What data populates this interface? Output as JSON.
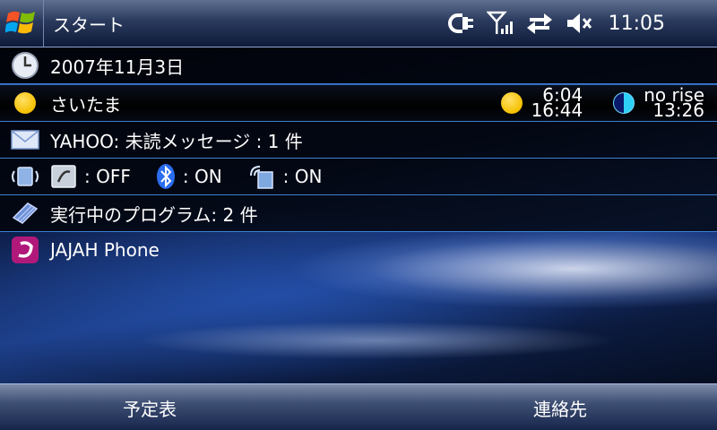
{
  "titlebar": {
    "title": "スタート",
    "time": "11:05",
    "icons": [
      "windows-logo-icon",
      "power-plug-icon",
      "signal-strength-icon",
      "data-transfer-icon",
      "speaker-mute-icon"
    ]
  },
  "today": {
    "date": {
      "text": "2007年11月3日",
      "icon": "clock-icon"
    },
    "weather": {
      "location": "さいたま",
      "icon": "sun-icon",
      "sunrise": "6:04",
      "sunset": "16:44",
      "moonrise": "no rise",
      "moonset": "13:26"
    },
    "mail": {
      "text": "YAHOO: 未読メッセージ : 1 件",
      "icon": "envelope-icon"
    },
    "wireless": {
      "icon": "wireless-manager-icon",
      "phone": {
        "icon": "phone-radio-icon",
        "label": ": OFF"
      },
      "bluetooth": {
        "icon": "bluetooth-icon",
        "label": ": ON"
      },
      "wifi": {
        "icon": "wifi-icon",
        "label": ": ON"
      }
    },
    "tasks": {
      "text": "実行中のプログラム: 2 件",
      "icon": "memory-chip-icon"
    },
    "app": {
      "text": "JAJAH Phone",
      "icon": "jajah-logo-icon"
    }
  },
  "softkeys": {
    "left": "予定表",
    "right": "連絡先"
  },
  "colors": {
    "accent_line": "#3e7fd3",
    "sun": "#f5c000",
    "moon": "#2fd0f5"
  }
}
